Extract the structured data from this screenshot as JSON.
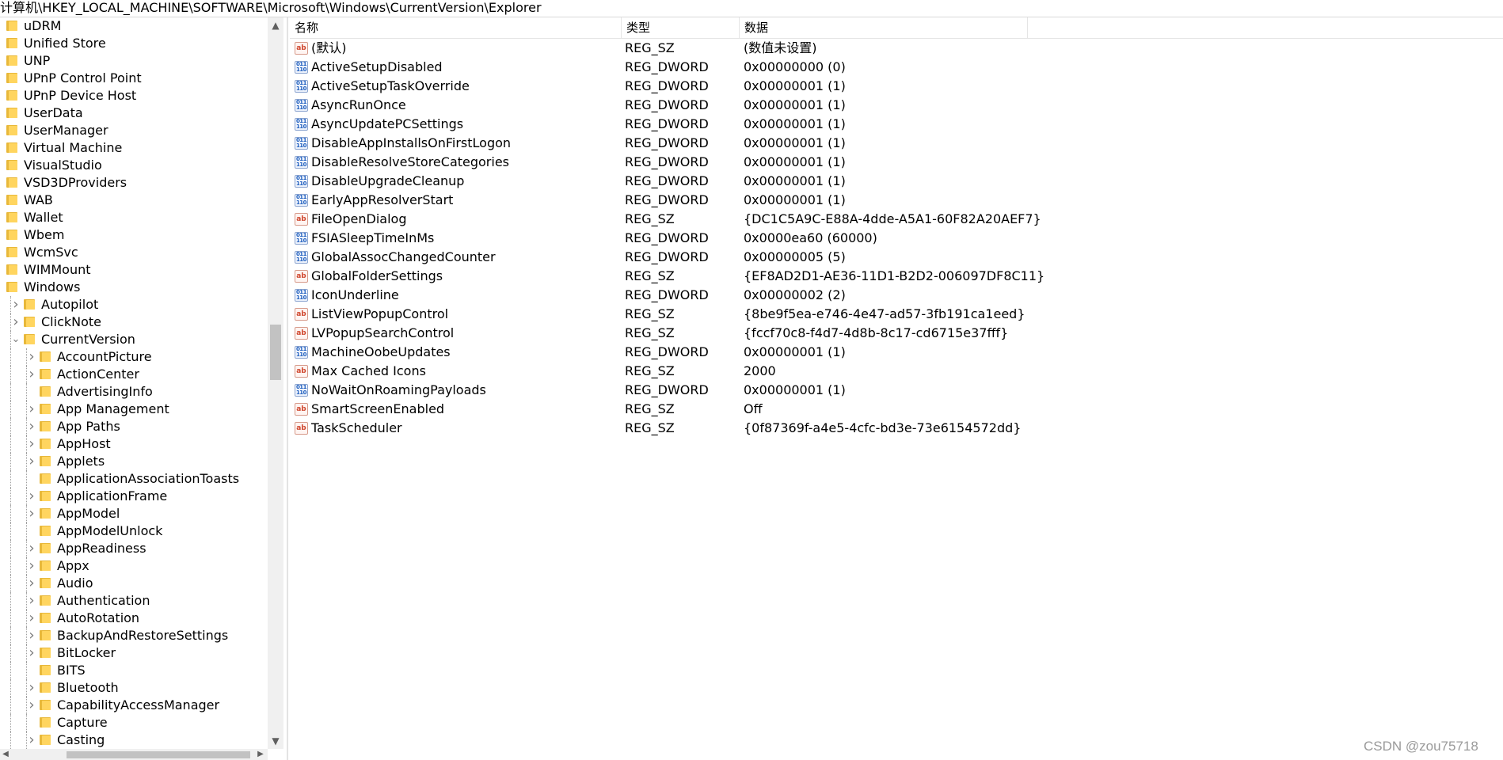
{
  "address": "计算机\\HKEY_LOCAL_MACHINE\\SOFTWARE\\Microsoft\\Windows\\CurrentVersion\\Explorer",
  "tree": {
    "items": [
      {
        "label": "uDRM",
        "level": 0,
        "expandable": false
      },
      {
        "label": "Unified Store",
        "level": 0,
        "expandable": false
      },
      {
        "label": "UNP",
        "level": 0,
        "expandable": false
      },
      {
        "label": "UPnP Control Point",
        "level": 0,
        "expandable": false
      },
      {
        "label": "UPnP Device Host",
        "level": 0,
        "expandable": false
      },
      {
        "label": "UserData",
        "level": 0,
        "expandable": false
      },
      {
        "label": "UserManager",
        "level": 0,
        "expandable": false
      },
      {
        "label": "Virtual Machine",
        "level": 0,
        "expandable": false
      },
      {
        "label": "VisualStudio",
        "level": 0,
        "expandable": false
      },
      {
        "label": "VSD3DProviders",
        "level": 0,
        "expandable": false
      },
      {
        "label": "WAB",
        "level": 0,
        "expandable": false
      },
      {
        "label": "Wallet",
        "level": 0,
        "expandable": false
      },
      {
        "label": "Wbem",
        "level": 0,
        "expandable": false
      },
      {
        "label": "WcmSvc",
        "level": 0,
        "expandable": false
      },
      {
        "label": "WIMMount",
        "level": 0,
        "expandable": false
      },
      {
        "label": "Windows",
        "level": 0,
        "expandable": false
      },
      {
        "label": "Autopilot",
        "level": 1,
        "expandable": true,
        "expanded": false
      },
      {
        "label": "ClickNote",
        "level": 1,
        "expandable": true,
        "expanded": false
      },
      {
        "label": "CurrentVersion",
        "level": 1,
        "expandable": true,
        "expanded": true
      },
      {
        "label": "AccountPicture",
        "level": 2,
        "expandable": true,
        "expanded": false
      },
      {
        "label": "ActionCenter",
        "level": 2,
        "expandable": true,
        "expanded": false
      },
      {
        "label": "AdvertisingInfo",
        "level": 2,
        "expandable": false
      },
      {
        "label": "App Management",
        "level": 2,
        "expandable": true,
        "expanded": false
      },
      {
        "label": "App Paths",
        "level": 2,
        "expandable": true,
        "expanded": false
      },
      {
        "label": "AppHost",
        "level": 2,
        "expandable": true,
        "expanded": false
      },
      {
        "label": "Applets",
        "level": 2,
        "expandable": true,
        "expanded": false
      },
      {
        "label": "ApplicationAssociationToasts",
        "level": 2,
        "expandable": false
      },
      {
        "label": "ApplicationFrame",
        "level": 2,
        "expandable": true,
        "expanded": false
      },
      {
        "label": "AppModel",
        "level": 2,
        "expandable": true,
        "expanded": false
      },
      {
        "label": "AppModelUnlock",
        "level": 2,
        "expandable": false
      },
      {
        "label": "AppReadiness",
        "level": 2,
        "expandable": true,
        "expanded": false
      },
      {
        "label": "Appx",
        "level": 2,
        "expandable": true,
        "expanded": false
      },
      {
        "label": "Audio",
        "level": 2,
        "expandable": true,
        "expanded": false
      },
      {
        "label": "Authentication",
        "level": 2,
        "expandable": true,
        "expanded": false
      },
      {
        "label": "AutoRotation",
        "level": 2,
        "expandable": true,
        "expanded": false
      },
      {
        "label": "BackupAndRestoreSettings",
        "level": 2,
        "expandable": true,
        "expanded": false
      },
      {
        "label": "BitLocker",
        "level": 2,
        "expandable": true,
        "expanded": false
      },
      {
        "label": "BITS",
        "level": 2,
        "expandable": false
      },
      {
        "label": "Bluetooth",
        "level": 2,
        "expandable": true,
        "expanded": false
      },
      {
        "label": "CapabilityAccessManager",
        "level": 2,
        "expandable": true,
        "expanded": false
      },
      {
        "label": "Capture",
        "level": 2,
        "expandable": false
      },
      {
        "label": "Casting",
        "level": 2,
        "expandable": true,
        "expanded": false
      }
    ]
  },
  "columns": {
    "name": "名称",
    "type": "类型",
    "data": "数据"
  },
  "values": [
    {
      "icon": "sz",
      "name": "(默认)",
      "type": "REG_SZ",
      "data": "(数值未设置)"
    },
    {
      "icon": "dword",
      "name": "ActiveSetupDisabled",
      "type": "REG_DWORD",
      "data": "0x00000000 (0)"
    },
    {
      "icon": "dword",
      "name": "ActiveSetupTaskOverride",
      "type": "REG_DWORD",
      "data": "0x00000001 (1)"
    },
    {
      "icon": "dword",
      "name": "AsyncRunOnce",
      "type": "REG_DWORD",
      "data": "0x00000001 (1)"
    },
    {
      "icon": "dword",
      "name": "AsyncUpdatePCSettings",
      "type": "REG_DWORD",
      "data": "0x00000001 (1)"
    },
    {
      "icon": "dword",
      "name": "DisableAppInstallsOnFirstLogon",
      "type": "REG_DWORD",
      "data": "0x00000001 (1)"
    },
    {
      "icon": "dword",
      "name": "DisableResolveStoreCategories",
      "type": "REG_DWORD",
      "data": "0x00000001 (1)"
    },
    {
      "icon": "dword",
      "name": "DisableUpgradeCleanup",
      "type": "REG_DWORD",
      "data": "0x00000001 (1)"
    },
    {
      "icon": "dword",
      "name": "EarlyAppResolverStart",
      "type": "REG_DWORD",
      "data": "0x00000001 (1)"
    },
    {
      "icon": "sz",
      "name": "FileOpenDialog",
      "type": "REG_SZ",
      "data": "{DC1C5A9C-E88A-4dde-A5A1-60F82A20AEF7}"
    },
    {
      "icon": "dword",
      "name": "FSIASleepTimeInMs",
      "type": "REG_DWORD",
      "data": "0x0000ea60 (60000)"
    },
    {
      "icon": "dword",
      "name": "GlobalAssocChangedCounter",
      "type": "REG_DWORD",
      "data": "0x00000005 (5)"
    },
    {
      "icon": "sz",
      "name": "GlobalFolderSettings",
      "type": "REG_SZ",
      "data": "{EF8AD2D1-AE36-11D1-B2D2-006097DF8C11}"
    },
    {
      "icon": "dword",
      "name": "IconUnderline",
      "type": "REG_DWORD",
      "data": "0x00000002 (2)"
    },
    {
      "icon": "sz",
      "name": "ListViewPopupControl",
      "type": "REG_SZ",
      "data": "{8be9f5ea-e746-4e47-ad57-3fb191ca1eed}"
    },
    {
      "icon": "sz",
      "name": "LVPopupSearchControl",
      "type": "REG_SZ",
      "data": "{fccf70c8-f4d7-4d8b-8c17-cd6715e37fff}"
    },
    {
      "icon": "dword",
      "name": "MachineOobeUpdates",
      "type": "REG_DWORD",
      "data": "0x00000001 (1)"
    },
    {
      "icon": "sz",
      "name": "Max Cached Icons",
      "type": "REG_SZ",
      "data": "2000"
    },
    {
      "icon": "dword",
      "name": "NoWaitOnRoamingPayloads",
      "type": "REG_DWORD",
      "data": "0x00000001 (1)"
    },
    {
      "icon": "sz",
      "name": "SmartScreenEnabled",
      "type": "REG_SZ",
      "data": "Off"
    },
    {
      "icon": "sz",
      "name": "TaskScheduler",
      "type": "REG_SZ",
      "data": "{0f87369f-a4e5-4cfc-bd3e-73e6154572dd}"
    }
  ],
  "icon_text": {
    "sz": "ab",
    "dword": "011\n110"
  },
  "watermark": "CSDN @zou75718"
}
